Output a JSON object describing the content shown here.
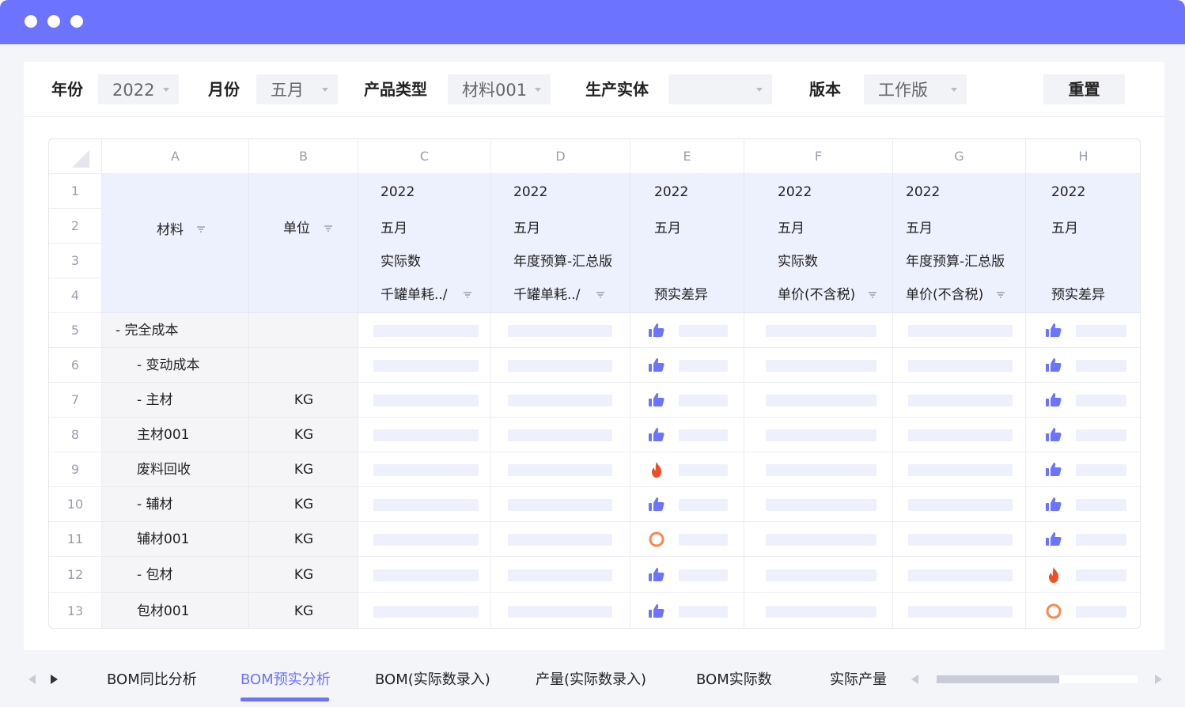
{
  "filters": {
    "year": {
      "label": "年份",
      "value": "2022"
    },
    "month": {
      "label": "月份",
      "value": "五月"
    },
    "product_type": {
      "label": "产品类型",
      "value": "材料001"
    },
    "entity": {
      "label": "生产实体",
      "value": ""
    },
    "version": {
      "label": "版本",
      "value": "工作版"
    },
    "reset_label": "重置"
  },
  "sheet": {
    "col_letters": [
      "A",
      "B",
      "C",
      "D",
      "E",
      "F",
      "G",
      "H"
    ],
    "row_numbers": [
      "1",
      "2",
      "3",
      "4",
      "5",
      "6",
      "7",
      "8",
      "9",
      "10",
      "11",
      "12",
      "13"
    ],
    "header_material": "材料",
    "header_unit": "单位",
    "header_columns": [
      {
        "year": "2022",
        "month": "五月",
        "type": "实际数",
        "measure": "千罐单耗../"
      },
      {
        "year": "2022",
        "month": "五月",
        "type": "年度预算-汇总版",
        "measure": "千罐单耗../"
      },
      {
        "year": "2022",
        "month": "五月",
        "type": "",
        "measure": "预实差异"
      },
      {
        "year": "2022",
        "month": "五月",
        "type": "实际数",
        "measure": "单价(不含税)"
      },
      {
        "year": "2022",
        "month": "五月",
        "type": "年度预算-汇总版",
        "measure": "单价(不含税)"
      },
      {
        "year": "2022",
        "month": "五月",
        "type": "",
        "measure": "预实差异"
      }
    ],
    "rows": [
      {
        "label": "- 完全成本",
        "unit": "",
        "e_icon": "thumbs-up",
        "h_icon": "thumbs-up"
      },
      {
        "label": "- 变动成本",
        "unit": "",
        "e_icon": "thumbs-up",
        "h_icon": "thumbs-up"
      },
      {
        "label": "- 主材",
        "unit": "KG",
        "e_icon": "thumbs-up",
        "h_icon": "thumbs-up"
      },
      {
        "label": "主材001",
        "unit": "KG",
        "e_icon": "thumbs-up",
        "h_icon": "thumbs-up"
      },
      {
        "label": "废料回收",
        "unit": "KG",
        "e_icon": "fire",
        "h_icon": "thumbs-up"
      },
      {
        "label": "- 辅材",
        "unit": "KG",
        "e_icon": "thumbs-up",
        "h_icon": "thumbs-up"
      },
      {
        "label": "辅材001",
        "unit": "KG",
        "e_icon": "circle",
        "h_icon": "thumbs-up"
      },
      {
        "label": "- 包材",
        "unit": "KG",
        "e_icon": "thumbs-up",
        "h_icon": "fire"
      },
      {
        "label": "包材001",
        "unit": "KG",
        "e_icon": "thumbs-up",
        "h_icon": "circle"
      }
    ]
  },
  "tabs": [
    "BOM同比分析",
    "BOM预实分析",
    "BOM(实际数录入)",
    "产量(实际数录入)",
    "BOM实际数",
    "实际产量"
  ],
  "active_tab": 1,
  "colors": {
    "accent": "#6b73ff",
    "icon_blue": "#6b73ff",
    "fire": "#f04e23",
    "circle": "#f7894a"
  }
}
